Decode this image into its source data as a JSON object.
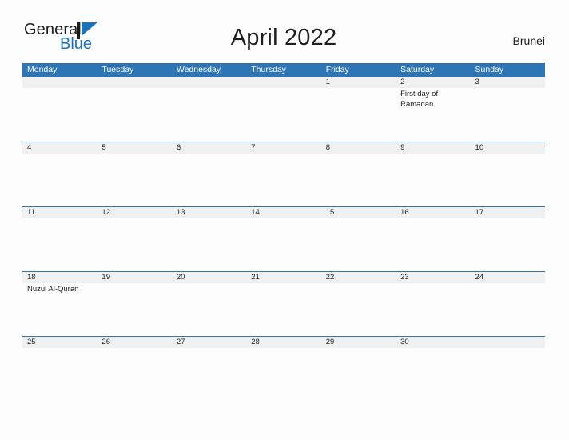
{
  "brand": {
    "name_top": "General",
    "name_bottom": "Blue",
    "mark": "triangle-logo-icon",
    "color_primary": "#1b72b8",
    "color_text": "#1b1b1b"
  },
  "header": {
    "title": "April 2022",
    "region": "Brunei"
  },
  "theme": {
    "header_blue": "#2e75b6",
    "band_gray": "#f0f0f0",
    "page_bg": "#fdfdfd",
    "text": "#1f1f1f"
  },
  "calendar": {
    "weekday_headers": [
      "Monday",
      "Tuesday",
      "Wednesday",
      "Thursday",
      "Friday",
      "Saturday",
      "Sunday"
    ],
    "weeks": [
      [
        {
          "date": "",
          "events": []
        },
        {
          "date": "",
          "events": []
        },
        {
          "date": "",
          "events": []
        },
        {
          "date": "",
          "events": []
        },
        {
          "date": "1",
          "events": []
        },
        {
          "date": "2",
          "events": [
            "First day of Ramadan"
          ]
        },
        {
          "date": "3",
          "events": []
        }
      ],
      [
        {
          "date": "4",
          "events": []
        },
        {
          "date": "5",
          "events": []
        },
        {
          "date": "6",
          "events": []
        },
        {
          "date": "7",
          "events": []
        },
        {
          "date": "8",
          "events": []
        },
        {
          "date": "9",
          "events": []
        },
        {
          "date": "10",
          "events": []
        }
      ],
      [
        {
          "date": "11",
          "events": []
        },
        {
          "date": "12",
          "events": []
        },
        {
          "date": "13",
          "events": []
        },
        {
          "date": "14",
          "events": []
        },
        {
          "date": "15",
          "events": []
        },
        {
          "date": "16",
          "events": []
        },
        {
          "date": "17",
          "events": []
        }
      ],
      [
        {
          "date": "18",
          "events": [
            "Nuzul Al-Quran"
          ]
        },
        {
          "date": "19",
          "events": []
        },
        {
          "date": "20",
          "events": []
        },
        {
          "date": "21",
          "events": []
        },
        {
          "date": "22",
          "events": []
        },
        {
          "date": "23",
          "events": []
        },
        {
          "date": "24",
          "events": []
        }
      ],
      [
        {
          "date": "25",
          "events": []
        },
        {
          "date": "26",
          "events": []
        },
        {
          "date": "27",
          "events": []
        },
        {
          "date": "28",
          "events": []
        },
        {
          "date": "29",
          "events": []
        },
        {
          "date": "30",
          "events": []
        },
        {
          "date": "",
          "events": []
        }
      ]
    ]
  }
}
